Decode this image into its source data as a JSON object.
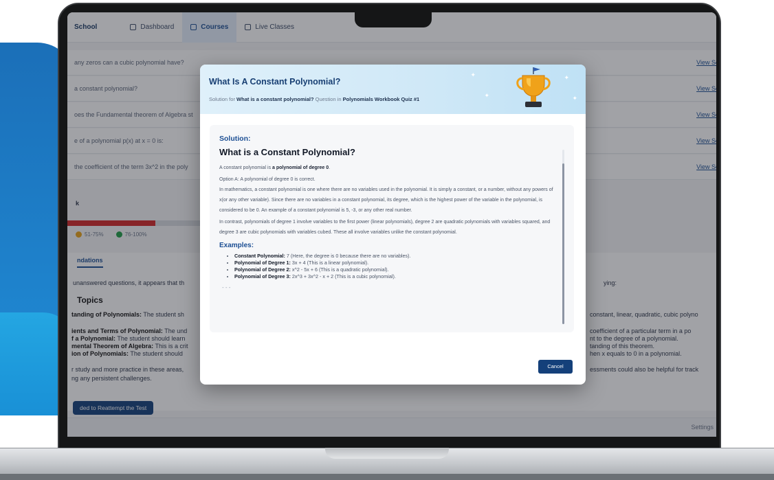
{
  "app": {
    "brand": "School",
    "nav": [
      {
        "label": "Dashboard",
        "icon": "dashboard-icon",
        "active": false
      },
      {
        "label": "Courses",
        "icon": "courses-icon",
        "active": true
      },
      {
        "label": "Live Classes",
        "icon": "live-classes-icon",
        "active": false
      }
    ]
  },
  "questions": [
    {
      "text": "any zeros can a cubic polynomial have?",
      "link": "View So"
    },
    {
      "text": "a constant polynomial?",
      "link": "View So"
    },
    {
      "text": "oes the Fundamental theorem of Algebra st",
      "link": "View So"
    },
    {
      "text": "e of a polynomial p(x) at x = 0 is:",
      "link": "View So"
    },
    {
      "text": "the coefficient of the term 3x^2 in the poly",
      "link": "View So"
    }
  ],
  "score": {
    "label": "k",
    "fill_fraction": 0.4,
    "legend": [
      {
        "label": "51-75%",
        "color": "#e8a317"
      },
      {
        "label": "76-100%",
        "color": "#1f9d46"
      }
    ]
  },
  "recommendations": {
    "tab": "ndations",
    "intro": "unanswered questions, it appears that th",
    "intro_right": "ying:",
    "topics_heading": "Topics",
    "items": [
      {
        "title": "tanding of Polynomials:",
        "text": " The student sh",
        "right": "constant, linear, quadratic, cubic polyno"
      },
      {
        "title": "ients and Terms of Polynomial:",
        "text": " The und",
        "right": "coefficient of a particular term in a po"
      },
      {
        "title": "f a Polynomial:",
        "text": " The student should learn",
        "right": "nt to the degree of a polynomial."
      },
      {
        "title": "mental Theorem of Algebra:",
        "text": " This is a crit",
        "right": "tanding of this theorem."
      },
      {
        "title": "ion of Polynomials:",
        "text": " The student should",
        "right": "hen x equals to 0 in a polynomial."
      }
    ],
    "closing_1": "r study and more practice in these areas,",
    "closing_2": "ng any persistent challenges.",
    "closing_right": "essments could also be helpful for track",
    "retry_button": "ded to Reattempt the Test",
    "footer_right": "Settings"
  },
  "modal": {
    "title": "What Is A Constant Polynomial?",
    "sub_prefix": "Solution for ",
    "sub_question": "What is a constant polynomial?",
    "sub_mid": " Question in ",
    "sub_quiz": "Polynomials Workbook Quiz #1",
    "solution_label": "Solution:",
    "solution_title": "What is a Constant Polynomial?",
    "p1_prefix": "A constant polynomial is ",
    "p1_bold": "a polynomial of degree 0",
    "p1_suffix": ".",
    "p2": "Option A: A polynomial of degree 0 is correct.",
    "p3": "In mathematics, a constant polynomial is one where there are no variables used in the polynomial. It is simply a constant, or a number, without any powers of x(or any other variable). Since there are no variables in a constant polynomial, its degree, which is the highest power of the variable in the polynomial, is considered to be 0. An example of a constant polynomial is 5, -3, or any other real number.",
    "p4": "In contrast, polynomials of degree 1 involve variables to the first power (linear polynomials), degree 2 are quadratic polynomials with variables squared, and degree 3 are cubic polynomials with variables cubed. These all involve variables unlike the constant polynomial.",
    "examples_label": "Examples:",
    "examples": [
      {
        "title": "Constant Polynomial:",
        "text": " 7 (Here, the degree is 0 because there are no variables)."
      },
      {
        "title": "Polynomial of Degree 1:",
        "text": " 3x + 4 (This is a linear polynomial)."
      },
      {
        "title": "Polynomial of Degree 2:",
        "text": " x^2 - 5x + 6 (This is a quadratic polynomial)."
      },
      {
        "title": "Polynomial of Degree 3:",
        "text": " 2x^3 + 3x^2 - x + 2 (This is a cubic polynomial)."
      }
    ],
    "ellipsis": "- - -",
    "cancel": "Cancel",
    "accent": "#1b4e93"
  }
}
